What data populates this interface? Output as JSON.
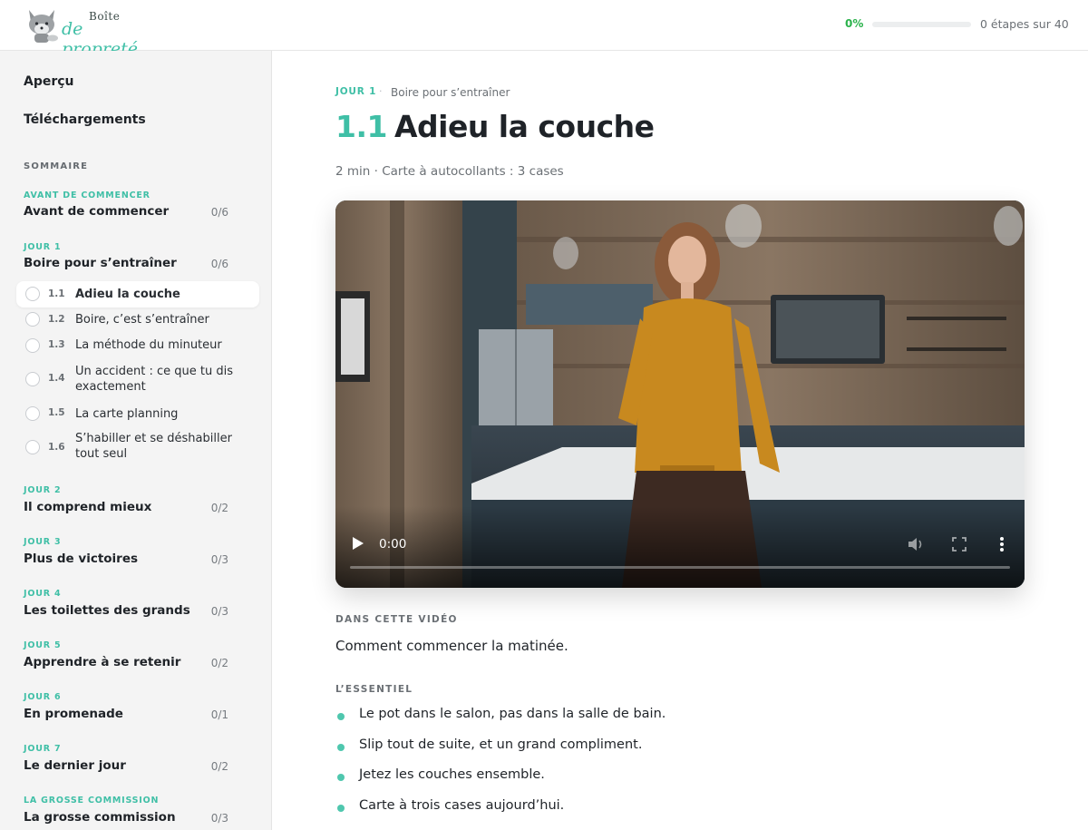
{
  "header": {
    "logo_small": "Boîte",
    "logo_big": "de propreté",
    "progress_percent": "0%",
    "progress_fraction": 0,
    "progress_text": "0 étapes sur 40"
  },
  "sidebar": {
    "overview": "Aperçu",
    "downloads": "Téléchargements",
    "section_title": "SOMMAIRE",
    "days": [
      {
        "tag": "AVANT DE COMMENCER",
        "title": "Avant de commencer",
        "count": "0/6"
      },
      {
        "tag": "JOUR 1",
        "title": "Boire pour s’entraîner",
        "count": "0/6"
      },
      {
        "tag": "JOUR 2",
        "title": "Il comprend mieux",
        "count": "0/2"
      },
      {
        "tag": "JOUR 3",
        "title": "Plus de victoires",
        "count": "0/3"
      },
      {
        "tag": "JOUR 4",
        "title": "Les toilettes des grands",
        "count": "0/3"
      },
      {
        "tag": "JOUR 5",
        "title": "Apprendre à se retenir",
        "count": "0/2"
      },
      {
        "tag": "JOUR 6",
        "title": "En promenade",
        "count": "0/1"
      },
      {
        "tag": "JOUR 7",
        "title": "Le dernier jour",
        "count": "0/2"
      },
      {
        "tag": "LA GROSSE COMMISSION",
        "title": "La grosse commission",
        "count": "0/3"
      }
    ],
    "lessons": [
      {
        "num": "1.1",
        "label": "Adieu la couche",
        "active": true
      },
      {
        "num": "1.2",
        "label": "Boire, c’est s’entraîner",
        "active": false
      },
      {
        "num": "1.3",
        "label": "La méthode du minuteur",
        "active": false
      },
      {
        "num": "1.4",
        "label": "Un accident : ce que tu dis exactement",
        "active": false
      },
      {
        "num": "1.5",
        "label": "La carte planning",
        "active": false
      },
      {
        "num": "1.6",
        "label": "S’habiller et se déshabiller tout seul",
        "active": false
      }
    ]
  },
  "main": {
    "breadcrumb_day": "JOUR 1",
    "breadcrumb_separator": "·",
    "breadcrumb_title": "Boire pour s’entraîner",
    "lesson_number": "1.1",
    "lesson_title": "Adieu la couche",
    "meta": "2 min · Carte à autocollants : 3 cases",
    "video": {
      "time": "0:00",
      "controls": [
        "play-icon",
        "volume-icon",
        "fullscreen-icon",
        "more-options-icon"
      ]
    },
    "in_video_label": "DANS CETTE VIDÉO",
    "in_video_text": "Comment commencer la matinée.",
    "essentials_label": "L’ESSENTIEL",
    "essentials": [
      "Le pot dans le salon, pas dans la salle de bain.",
      "Slip tout de suite, et un grand compliment.",
      "Jetez les couches ensemble.",
      "Carte à trois cases aujourd’hui."
    ]
  },
  "colors": {
    "accent": "#3fbfa6",
    "progress_green": "#2bb24c",
    "sidebar_bg": "#f4f4f4",
    "text": "#1f2328"
  }
}
